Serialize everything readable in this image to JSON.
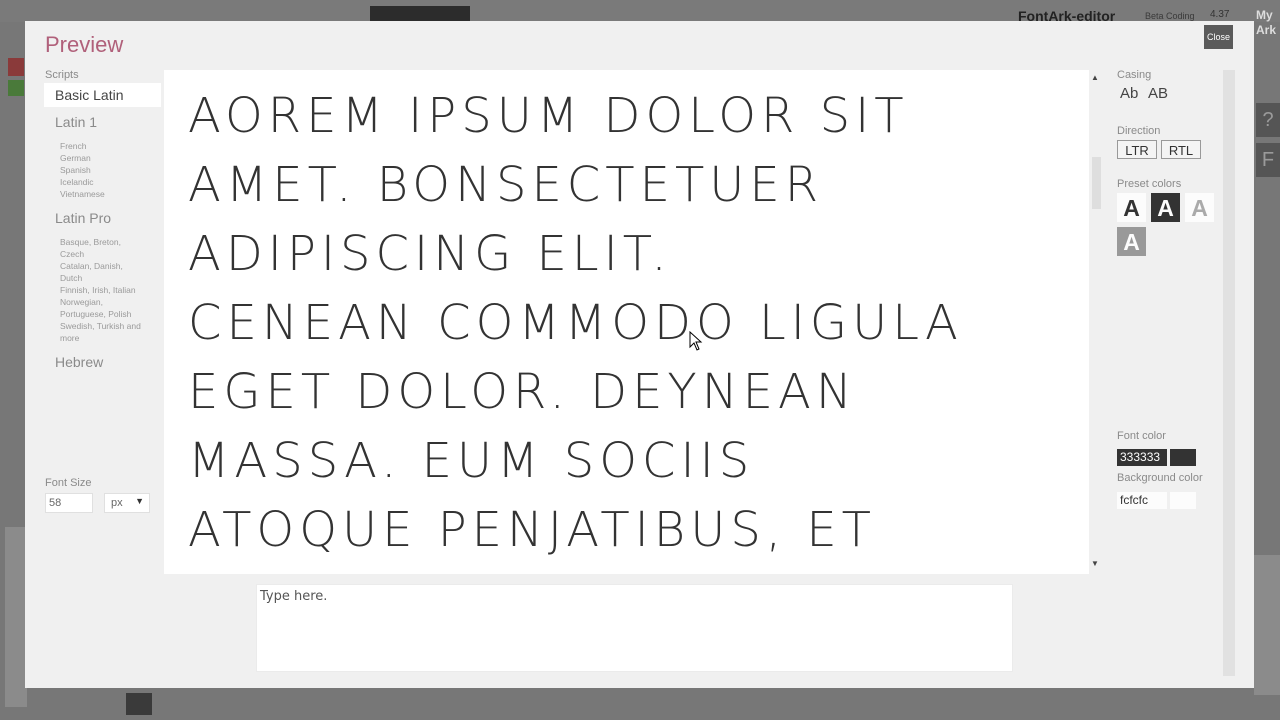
{
  "background_app": {
    "title": "FontArk-editor",
    "subtitle": "Beta Coding",
    "version": "4.37",
    "my_label": "My Ark",
    "help_glyph": "?",
    "f_glyph": "F"
  },
  "modal": {
    "title": "Preview",
    "close_label": "Close"
  },
  "scripts": {
    "label": "Scripts",
    "items": [
      {
        "label": "Basic Latin",
        "active": true,
        "sub": ""
      },
      {
        "label": "Latin 1",
        "active": false,
        "sub": "French German Spanish Icelandic Vietnamese"
      },
      {
        "label": "Latin Pro",
        "active": false,
        "sub": "Basque, Breton, Czech Catalan, Danish, Dutch Finnish, Irish, Italian Norwegian, Portuguese, Polish Swedish, Turkish and more"
      },
      {
        "label": "Hebrew",
        "active": false,
        "sub": ""
      }
    ],
    "latin1_sub": [
      "French",
      "German",
      "Spanish",
      "Icelandic",
      "Vietnamese"
    ],
    "latinpro_sub": [
      "Basque, Breton,",
      "Czech",
      "Catalan, Danish,",
      "Dutch",
      "Finnish, Irish, Italian",
      "Norwegian,",
      "Portuguese, Polish",
      "Swedish, Turkish and",
      "more"
    ]
  },
  "font_size": {
    "label": "Font Size",
    "value": "58",
    "unit": "px"
  },
  "preview": {
    "lines": [
      "Aorem ipsum dolor sit",
      "amet. Bonsectetuer",
      "adipiscing elit.",
      "Cenean commodo ligula",
      "eget dolor. Deynean",
      "massa. Eum sociis",
      "atoque penjatibus, et"
    ],
    "scroll_up": "▲",
    "scroll_down": "▼"
  },
  "input": {
    "placeholder": "Type here."
  },
  "casing": {
    "label": "Casing",
    "option_mixed": "Ab",
    "option_upper": "AB"
  },
  "direction": {
    "label": "Direction",
    "ltr": "LTR",
    "rtl": "RTL"
  },
  "preset_colors": {
    "label": "Preset colors",
    "glyph": "A",
    "swatches": [
      {
        "fg": "#333333",
        "bg": "#fcfcfc"
      },
      {
        "fg": "#fcfcfc",
        "bg": "#333333"
      },
      {
        "fg": "#999999",
        "bg": "#fcfcfc"
      },
      {
        "fg": "#fcfcfc",
        "bg": "#999999"
      }
    ]
  },
  "font_color": {
    "label": "Font color",
    "value": "333333",
    "hex": "#333333"
  },
  "background_color": {
    "label": "Background color",
    "value": "fcfcfc",
    "hex": "#fcfcfc"
  }
}
